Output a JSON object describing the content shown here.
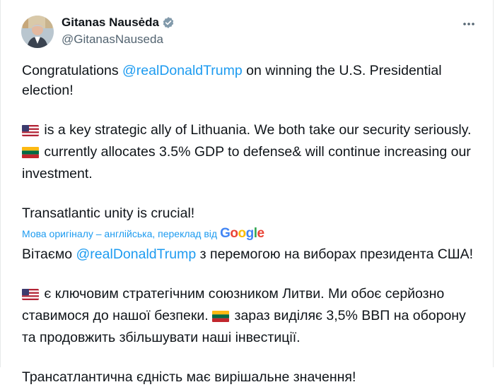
{
  "author": {
    "display_name": "Gitanas Nausėda",
    "handle": "@GitanasNauseda",
    "verified_icon": "verified-badge-icon",
    "avatar_icon": "avatar"
  },
  "more_icon": "more-options-icon",
  "original": {
    "p1_before": "Congratulations ",
    "p1_mention": "@realDonaldTrump",
    "p1_after": " on winning the U.S. Presidential election!",
    "p2_a": " is a key strategic ally of Lithuania. We both take our security seriously. ",
    "p2_b": " currently allocates 3.5% GDP to defense& will continue increasing our investment.",
    "p3": "Transatlantic unity is crucial!"
  },
  "translation_notice": {
    "label": "Мова оригіналу – англійська, переклад від",
    "provider": "Google"
  },
  "translated": {
    "p1_before": "Вітаємо ",
    "p1_mention": "@realDonaldTrump",
    "p1_after": " з перемогою на виборах президента США!",
    "p2_a": " є ключовим стратегічним союзником Литви. Ми обоє серйозно ставимося до нашої безпеки. ",
    "p2_b": " зараз виділяє 3,5% ВВП на оборону та продовжить збільшувати наші інвестиції.",
    "p3": "Трансатлантична єдність має вирішальне значення!"
  },
  "colors": {
    "link": "#1d9bf0",
    "text": "#0f1419",
    "secondary": "#536471"
  }
}
